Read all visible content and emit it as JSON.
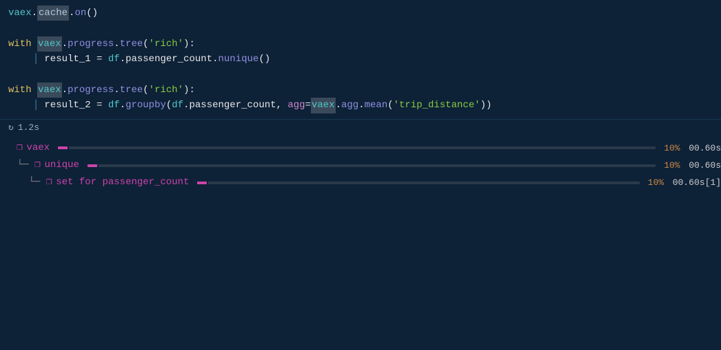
{
  "code": {
    "line1": "vaex.cache.on()",
    "line1_parts": {
      "vaex": "vaex",
      "dot1": ".",
      "cache": "cache",
      "dot2": ".",
      "on": "on()"
    },
    "line2_with": "with ",
    "line2_vaex": "vaex",
    "line2_rest": ".progress.tree('rich'):",
    "line3_indent": "    result_1 = df.passenger_count.nunique()",
    "line4_with": "with ",
    "line4_vaex": "vaex",
    "line4_rest": ".progress.tree('rich'):",
    "line5_indent": "    result_2 = df.groupby(df.passenger_count, agg=",
    "line5_vaex2": "vaex",
    "line5_end": ".agg.mean('trip_distance'))"
  },
  "timing": {
    "icon": "↻",
    "value": "1.2s"
  },
  "progress": {
    "rows": [
      {
        "indent": "",
        "connector": "",
        "hash": "❒",
        "label": "vaex",
        "pct": "10%",
        "time": "00.60s",
        "extra": ""
      },
      {
        "indent": "  └─",
        "connector": "",
        "hash": "❒",
        "label": "unique",
        "pct": "10%",
        "time": "00.60s",
        "extra": ""
      },
      {
        "indent": "    └─",
        "connector": "",
        "hash": "❒",
        "label": "set for passenger_count",
        "pct": "10%",
        "time": "00.60s",
        "extra": "[1]"
      }
    ]
  }
}
